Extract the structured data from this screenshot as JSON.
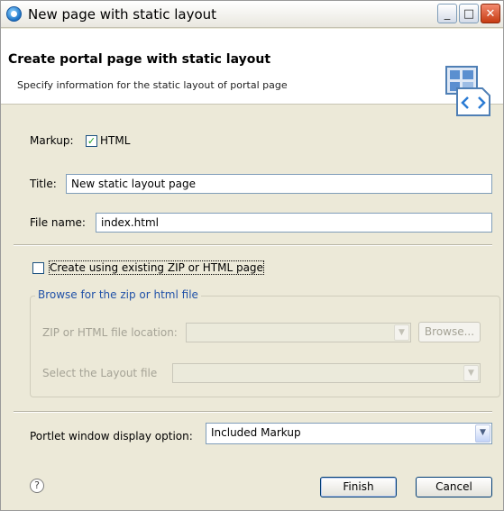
{
  "window": {
    "title": "New page with static layout"
  },
  "header": {
    "title": "Create portal page with static layout",
    "description": "Specify information for the static layout of portal page"
  },
  "form": {
    "markup_label": "Markup:",
    "markup_checkbox_label": "HTML",
    "markup_checked": true,
    "title_label": "Title:",
    "title_value": "New static layout page",
    "filename_label": "File name:",
    "filename_value": "index.html",
    "create_existing_label": "Create using existing ZIP or HTML page",
    "create_existing_checked": false,
    "browse_group_label": "Browse for the zip or html file",
    "zip_location_label": "ZIP or HTML file location:",
    "zip_location_value": "",
    "browse_button_label": "Browse...",
    "layout_file_label": "Select the Layout file",
    "layout_file_value": "",
    "portlet_option_label": "Portlet window display option:",
    "portlet_option_value": "Included Markup"
  },
  "footer": {
    "help_icon": "?",
    "finish_label": "Finish",
    "cancel_label": "Cancel"
  },
  "icons": {
    "app": "eclipse-globe-icon",
    "header": "page-layout-icon",
    "help": "help-icon"
  },
  "colors": {
    "dialog_bg": "#ece9d8",
    "group_legend": "#2152a8",
    "close_button": "#c63b12",
    "check_mark": "#21a121"
  }
}
